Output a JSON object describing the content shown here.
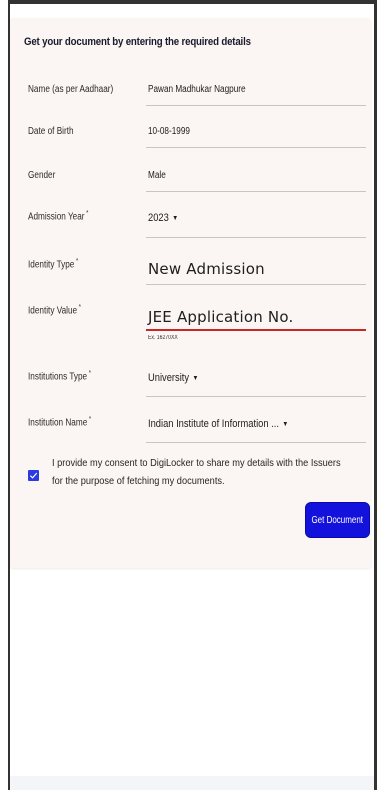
{
  "form": {
    "title": "Get your document by entering the required details",
    "fields": [
      {
        "label": "Name (as per Aadhaar)",
        "value": "Pawan Madhukar Nagpure"
      },
      {
        "label": "Date of Birth",
        "value": "10-08-1999"
      },
      {
        "label": "Gender",
        "value": "Male"
      },
      {
        "label": "Admission Year",
        "value": "2023"
      },
      {
        "label": "Identity Type",
        "value": "New Admission"
      },
      {
        "label": "Identity Value",
        "value": "JEE Application No.",
        "hint": "Ex. 16270XX"
      },
      {
        "label": "Institutions Type",
        "value": "University"
      },
      {
        "label": "Institution Name",
        "value": "Indian Institute of Information ..."
      }
    ],
    "required_mark": "*",
    "consent": {
      "checked": true,
      "text": "I provide my consent to DigiLocker to share my details with the Issuers for the purpose of fetching my documents."
    },
    "submit_label": "Get Document"
  },
  "colors": {
    "card_bg": "#fbf5f3",
    "button_bg": "#1212dc",
    "checkbox_bg": "#2b3be0",
    "error_underline": "#c62828"
  },
  "icons": {
    "dropdown": "caret-down-icon",
    "checkbox": "checkmark-icon"
  }
}
